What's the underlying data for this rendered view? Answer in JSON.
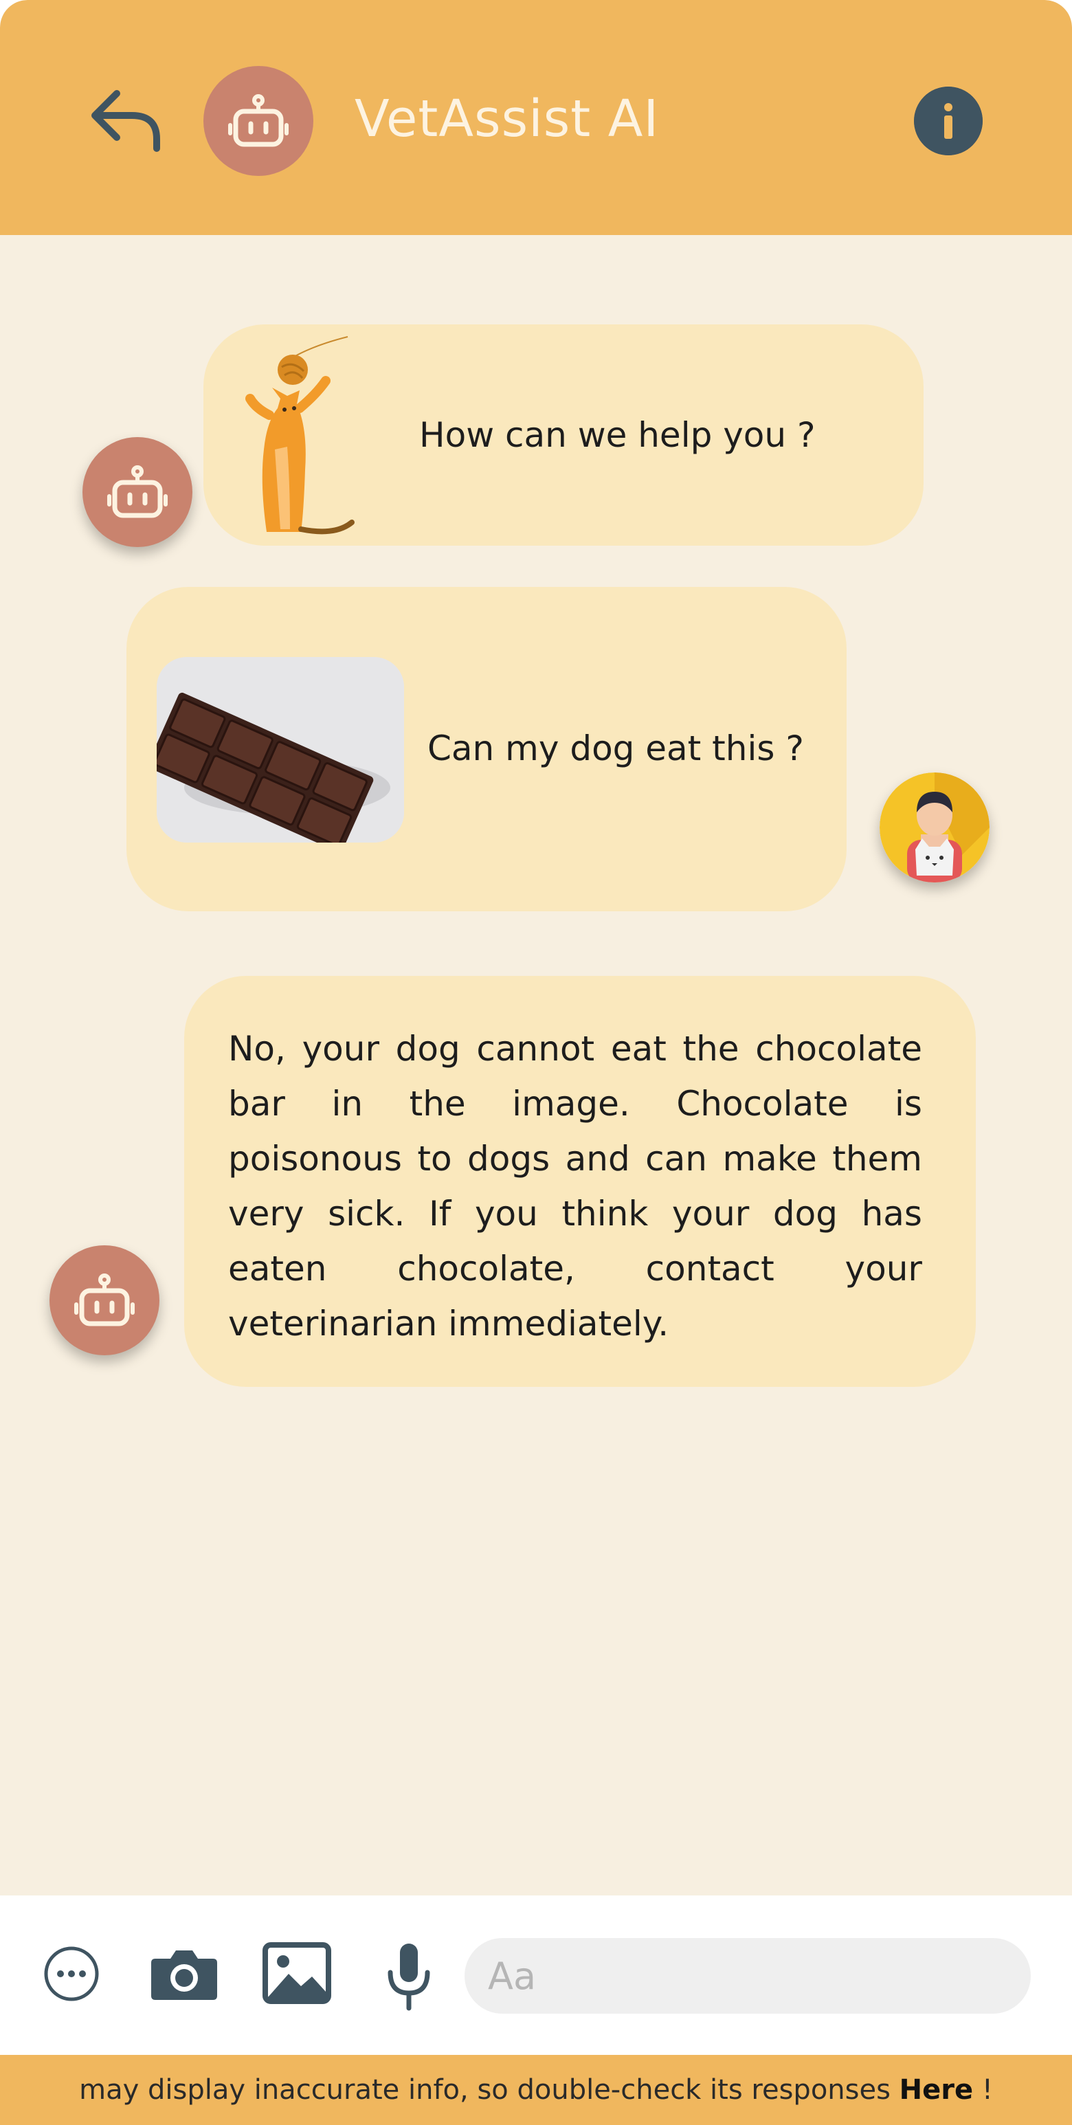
{
  "header": {
    "title": "VetAssist AI"
  },
  "messages": [
    {
      "sender": "bot",
      "text": "How can we help you ?"
    },
    {
      "sender": "user",
      "text": "Can my dog eat this ?"
    },
    {
      "sender": "bot",
      "text": "No, your dog cannot eat the chocolate bar in the image. Chocolate is poisonous to dogs and can make them very sick. If you think your dog has eaten chocolate, contact your veterinarian immediately."
    }
  ],
  "composer": {
    "placeholder": "Aa"
  },
  "footer": {
    "text": "may display inaccurate info, so double-check its responses",
    "link_label": "Here",
    "suffix": " !"
  },
  "colors": {
    "header": "#f0b75e",
    "background": "#f7efe0",
    "bubble": "#fae8bd",
    "bot_avatar": "#c9836e",
    "icon_dark": "#3f5461"
  }
}
